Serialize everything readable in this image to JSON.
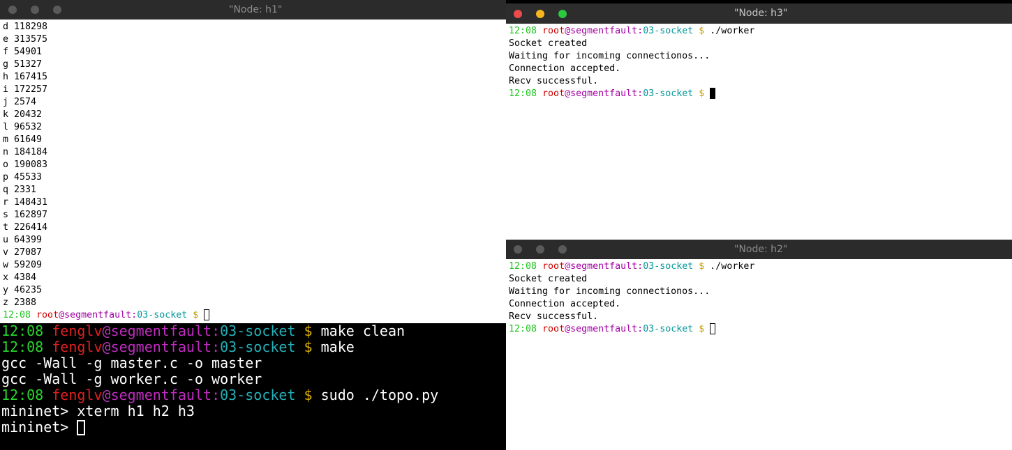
{
  "windows": {
    "h1": {
      "title": "\"Node: h1\"",
      "counts": [
        "d 118298",
        "e 313575",
        "f 54901",
        "g 51327",
        "h 167415",
        "i 172257",
        "j 2574",
        "k 20432",
        "l 96532",
        "m 61649",
        "n 184184",
        "o 190083",
        "p 45533",
        "q 2331",
        "r 148431",
        "s 162897",
        "t 226414",
        "u 64399",
        "v 27087",
        "w 59209",
        "x 4384",
        "y 46235",
        "z 2388"
      ],
      "prompt": {
        "time": "12:08",
        "user": "root",
        "at": "@",
        "host": "segmentfault",
        "colon": ":",
        "dir": "03-socket",
        "dollar": "$"
      }
    },
    "h3": {
      "title": "\"Node: h3\"",
      "prompt1": {
        "time": "12:08",
        "user": "root",
        "at": "@",
        "host": "segmentfault",
        "colon": ":",
        "dir": "03-socket",
        "dollar": "$",
        "cmd": "./worker"
      },
      "output": [
        "Socket created",
        "Waiting for incoming connectionos...",
        "Connection accepted.",
        "Recv successful."
      ],
      "prompt2": {
        "time": "12:08",
        "user": "root",
        "at": "@",
        "host": "segmentfault",
        "colon": ":",
        "dir": "03-socket",
        "dollar": "$"
      }
    },
    "h2": {
      "title": "\"Node: h2\"",
      "prompt1": {
        "time": "12:08",
        "user": "root",
        "at": "@",
        "host": "segmentfault",
        "colon": ":",
        "dir": "03-socket",
        "dollar": "$",
        "cmd": "./worker"
      },
      "output": [
        "Socket created",
        "Waiting for incoming connectionos...",
        "Connection accepted.",
        "Recv successful."
      ],
      "prompt2": {
        "time": "12:08",
        "user": "root",
        "at": "@",
        "host": "segmentfault",
        "colon": ":",
        "dir": "03-socket",
        "dollar": "$"
      }
    }
  },
  "main_terminal": {
    "lines": [
      {
        "type": "prompt",
        "time": "12:08",
        "user": "fenglv",
        "at": "@",
        "host": "segmentfault",
        "colon": ":",
        "dir": "03-socket",
        "dollar": "$",
        "cmd": "make clean"
      },
      {
        "type": "prompt",
        "time": "12:08",
        "user": "fenglv",
        "at": "@",
        "host": "segmentfault",
        "colon": ":",
        "dir": "03-socket",
        "dollar": "$",
        "cmd": "make"
      },
      {
        "type": "text",
        "text": "gcc -Wall -g master.c -o master"
      },
      {
        "type": "text",
        "text": "gcc -Wall -g worker.c -o worker"
      },
      {
        "type": "prompt",
        "time": "12:08",
        "user": "fenglv",
        "at": "@",
        "host": "segmentfault",
        "colon": ":",
        "dir": "03-socket",
        "dollar": "$",
        "cmd": "sudo ./topo.py"
      },
      {
        "type": "text",
        "text": "mininet> xterm h1 h2 h3"
      },
      {
        "type": "text",
        "text": "mininet> "
      }
    ]
  },
  "colors": {
    "titlebar_inactive": "#2b2b2b",
    "titlebar_active": "#2d2d2d",
    "close_red": "#ec4b4b",
    "minimize_yellow": "#f5b520",
    "zoom_green": "#2bc93f",
    "button_inactive": "#5a5a5a"
  }
}
